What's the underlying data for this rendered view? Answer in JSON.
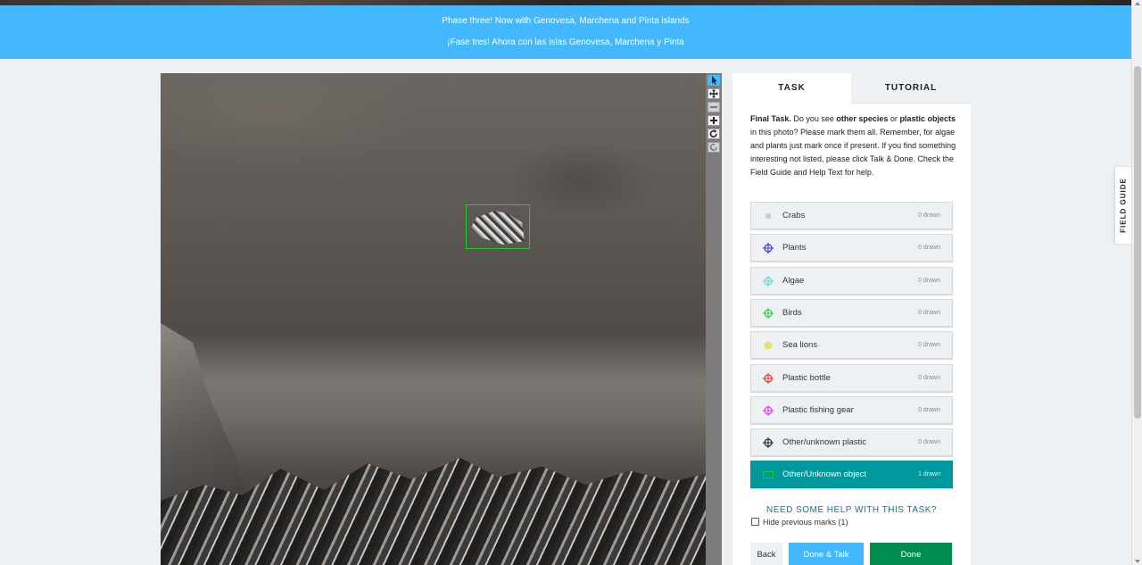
{
  "banner": {
    "line_en": "Phase three! Now with Genovesa, Marchena and Pinta islands",
    "line_es": "¡Fase tres! Ahora con las islas Genovesa, Marchena y Pinta"
  },
  "tabs": {
    "task": "TASK",
    "tutorial": "TUTORIAL"
  },
  "instructions": {
    "lead": "Final Task.",
    "t1": " Do you see ",
    "b1": "other species",
    "t2": " or ",
    "b2": "plastic objects",
    "t3": " in this photo? Please mark them all. Remember, for algae and plants just mark once if present. If you find something interesting not listed, please click Talk & Done. Check the Field Guide and Help Text for help."
  },
  "tools": [
    {
      "label": "Crabs",
      "count": "0 drawn",
      "icon": "crab-thumbnail-icon",
      "color": "#cccccc"
    },
    {
      "label": "Plants",
      "count": "0 drawn",
      "icon": "crosshair-icon",
      "color": "#3333dd"
    },
    {
      "label": "Algae",
      "count": "0 drawn",
      "icon": "crosshair-icon",
      "color": "#55dddd"
    },
    {
      "label": "Birds",
      "count": "0 drawn",
      "icon": "crosshair-icon",
      "color": "#33cc33"
    },
    {
      "label": "Sea lions",
      "count": "0 drawn",
      "icon": "circle-icon",
      "color": "#e8e070"
    },
    {
      "label": "Plastic bottle",
      "count": "0 drawn",
      "icon": "crosshair-icon",
      "color": "#ee3333"
    },
    {
      "label": "Plastic fishing gear",
      "count": "0 drawn",
      "icon": "crosshair-icon",
      "color": "#ee33ee"
    },
    {
      "label": "Other/unknown plastic",
      "count": "0 drawn",
      "icon": "crosshair-icon",
      "color": "#222222"
    },
    {
      "label": "Other/Unknown object",
      "count": "1 drawn",
      "icon": "rectangle-icon",
      "color": "#22cc22"
    }
  ],
  "help_link": "NEED SOME HELP WITH THIS TASK?",
  "hide_previous": "Hide previous marks (1)",
  "buttons": {
    "back": "Back",
    "done_talk": "Done & Talk",
    "done": "Done"
  },
  "field_guide": "FIELD GUIDE",
  "toolbar": {
    "pointer": "pointer-icon",
    "move": "move-icon",
    "zoom_out": "zoom-out-icon",
    "zoom_in": "zoom-in-icon",
    "rotate": "rotate-icon",
    "reset": "reset-icon"
  },
  "colors": {
    "banner": "#43b8ff",
    "active_tool": "#00979d",
    "done": "#008c4f",
    "done_talk": "#43b8ff",
    "mark": "#22cc22"
  }
}
